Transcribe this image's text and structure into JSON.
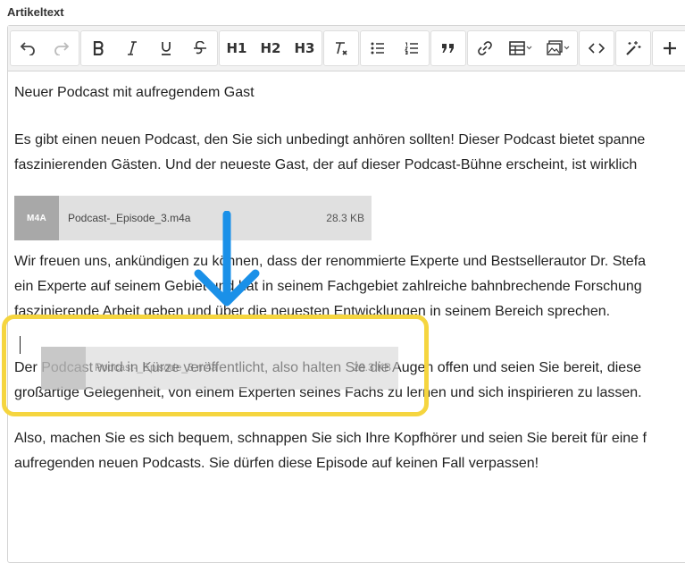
{
  "field_label": "Artikeltext",
  "toolbar": {
    "headings": [
      "H1",
      "H2",
      "H3"
    ]
  },
  "content": {
    "title": "Neuer Podcast mit aufregendem Gast",
    "para1_line1": "Es gibt einen neuen Podcast, den Sie sich unbedingt anhören sollten! Dieser Podcast bietet spanne",
    "para1_line2": "faszinierenden Gästen. Und der neueste Gast, der auf dieser Podcast-Bühne erscheint, ist wirklich",
    "para2_line1": "Wir freuen uns, ankündigen zu können, dass der renommierte Experte und Bestsellerautor Dr. Stefa",
    "para2_line2": "ein Experte auf seinem Gebiet und hat in seinem Fachgebiet zahlreiche bahnbrechende Forschung",
    "para2_line3": "faszinierende Arbeit geben und über die neuesten Entwicklungen in seinem Bereich sprechen.",
    "para3_line1": "Der Podcast wird in Kürze veröffentlicht, also halten Sie die Augen offen und seien Sie bereit, diese",
    "para3_line2": "großartige Gelegenheit, von einem Experten seines Fachs zu lernen und sich inspirieren zu lassen.",
    "para4_line1": "Also, machen Sie es sich bequem, schnappen Sie sich Ihre Kopfhörer und seien Sie bereit für eine f",
    "para4_line2": "aufregenden neuen Podcasts. Sie dürfen diese Episode auf keinen Fall verpassen!"
  },
  "attachment": {
    "type_badge": "M4A",
    "filename": "Podcast-_Episode_3.m4a",
    "size": "28.3 KB"
  },
  "colors": {
    "highlight": "#f5d53f",
    "arrow": "#1a90e8"
  }
}
